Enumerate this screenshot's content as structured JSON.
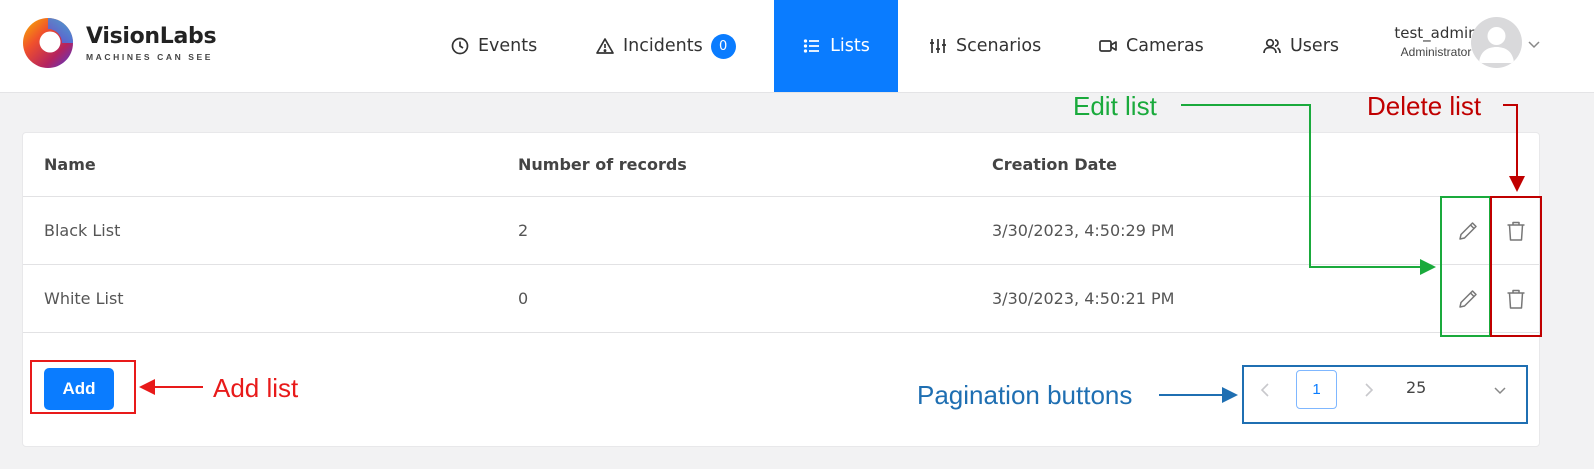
{
  "brand": {
    "name": "VisionLabs",
    "tagline": "MACHINES CAN SEE"
  },
  "nav": [
    {
      "label": "Events",
      "icon": "clock-icon"
    },
    {
      "label": "Incidents",
      "icon": "warning-icon",
      "badge": "0"
    },
    {
      "label": "Lists",
      "icon": "list-icon",
      "active": true
    },
    {
      "label": "Scenarios",
      "icon": "sliders-icon"
    },
    {
      "label": "Cameras",
      "icon": "video-camera-icon"
    },
    {
      "label": "Users",
      "icon": "users-icon"
    }
  ],
  "user": {
    "name": "test_admin",
    "role": "Administrator"
  },
  "table": {
    "columns": [
      "Name",
      "Number of records",
      "Creation Date"
    ],
    "rows": [
      {
        "name": "Black List",
        "count": "2",
        "date": "3/30/2023, 4:50:29 PM"
      },
      {
        "name": "White List",
        "count": "0",
        "date": "3/30/2023, 4:50:21 PM"
      }
    ]
  },
  "actions": {
    "add_label": "Add"
  },
  "pagination": {
    "current_page": "1",
    "page_size": "25"
  },
  "annotations": {
    "edit": "Edit list",
    "delete": "Delete list",
    "add": "Add list",
    "pagination": "Pagination buttons"
  },
  "colors": {
    "accent": "#0a7cff",
    "annotation_green": "#1aaa3c",
    "annotation_red": "#c00000",
    "annotation_bright_red": "#e81a1a",
    "annotation_blue": "#1f6fb2"
  }
}
